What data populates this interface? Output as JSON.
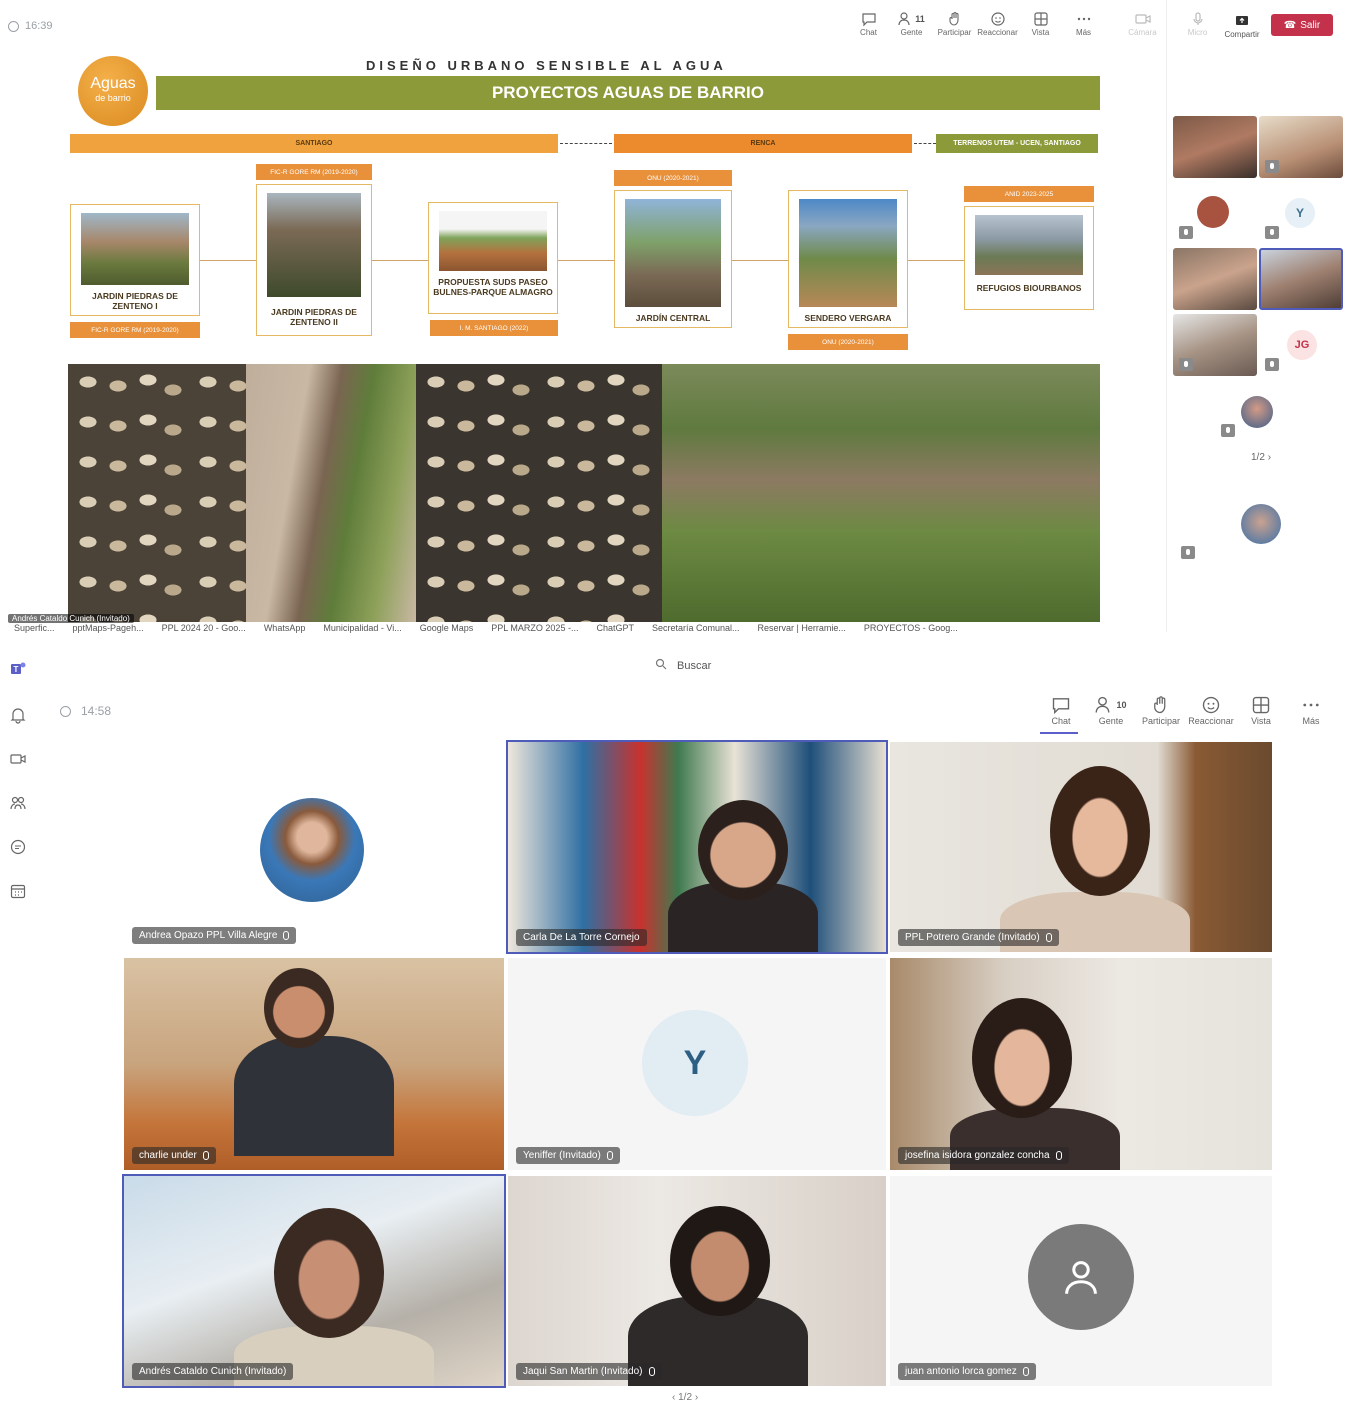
{
  "top_call": {
    "time": "16:39",
    "toolbar": [
      {
        "label": "Chat",
        "icon": "chat-icon"
      },
      {
        "label": "Gente",
        "icon": "people-icon",
        "count": "11"
      },
      {
        "label": "Participar",
        "icon": "raise-hand-icon"
      },
      {
        "label": "Reaccionar",
        "icon": "smiley-icon"
      },
      {
        "label": "Vista",
        "icon": "grid-icon"
      },
      {
        "label": "Más",
        "icon": "more-icon"
      },
      {
        "label": "Cámara",
        "icon": "camera-icon"
      },
      {
        "label": "Micro",
        "icon": "mic-icon"
      }
    ],
    "share_label": "Compartir",
    "leave_label": "Salir",
    "slide": {
      "logo_text": "Aguas",
      "logo_subtext": "de barrio",
      "title": "DISEÑO URBANO SENSIBLE AL AGUA",
      "banner": "PROYECTOS AGUAS DE BARRIO",
      "regions": [
        "SANTIAGO",
        "RENCA",
        "TERRENOS UTEM - UCEN, SANTIAGO"
      ],
      "projects": [
        {
          "name": "JARDIN PIEDRAS DE ZENTENO I",
          "tag": "FIC-R GORE RM (2019-2020)"
        },
        {
          "name": "JARDIN PIEDRAS DE ZENTENO II",
          "tag": "FIC-R GORE RM (2019-2020)"
        },
        {
          "name": "PROPUESTA SUDS PASEO BULNES-PARQUE ALMAGRO",
          "tag": "I. M. SANTIAGO (2022)"
        },
        {
          "name": "JARDÍN CENTRAL",
          "tag": "ONU (2020-2021)"
        },
        {
          "name": "SENDERO VERGARA",
          "tag": "ONU (2020-2021)"
        },
        {
          "name": "REFUGIOS BIOURBANOS",
          "tag": "ANID 2023-2025"
        }
      ]
    },
    "presenter_label": "Andrés Cataldo Cunich (Invitado)",
    "side_avatar_letters": [
      "Y",
      "JG"
    ],
    "pager": "1/2"
  },
  "bookmarks": [
    "Superfic...",
    "pptMaps-Pageh...",
    "PPL 2024 20 - Goo...",
    "WhatsApp",
    "Municipalidad - Vi...",
    "Google Maps",
    "PPL MARZO 2025 -...",
    "ChatGPT",
    "Secretaría Comunal...",
    "Reservar | Herramie...",
    "PROYECTOS - Goog..."
  ],
  "bottom_call": {
    "search_placeholder": "Buscar",
    "time": "14:58",
    "toolbar": [
      {
        "label": "Chat",
        "icon": "chat-icon"
      },
      {
        "label": "Gente",
        "icon": "people-icon",
        "count": "10"
      },
      {
        "label": "Participar",
        "icon": "raise-hand-icon"
      },
      {
        "label": "Reaccionar",
        "icon": "smiley-icon"
      },
      {
        "label": "Vista",
        "icon": "grid-icon"
      },
      {
        "label": "Más",
        "icon": "more-icon"
      }
    ],
    "participants": [
      {
        "name": "Andrea Opazo PPL Villa Alegre"
      },
      {
        "name": "Carla De La Torre Cornejo"
      },
      {
        "name": "PPL Potrero Grande (Invitado)"
      },
      {
        "name": "charlie under"
      },
      {
        "name": "Yeniffer (Invitado)",
        "avatar_letter": "Y"
      },
      {
        "name": "josefina isidora gonzalez concha"
      },
      {
        "name": "Andrés Cataldo Cunich (Invitado)"
      },
      {
        "name": "Jaqui San Martin (Invitado)"
      },
      {
        "name": "juan antonio lorca gomez"
      }
    ],
    "pager": "1/2"
  },
  "colors": {
    "accent": "#5b5fc7",
    "leave": "#c4314b",
    "banner": "#8d9a3a",
    "tag_orange": "#e8903a"
  }
}
